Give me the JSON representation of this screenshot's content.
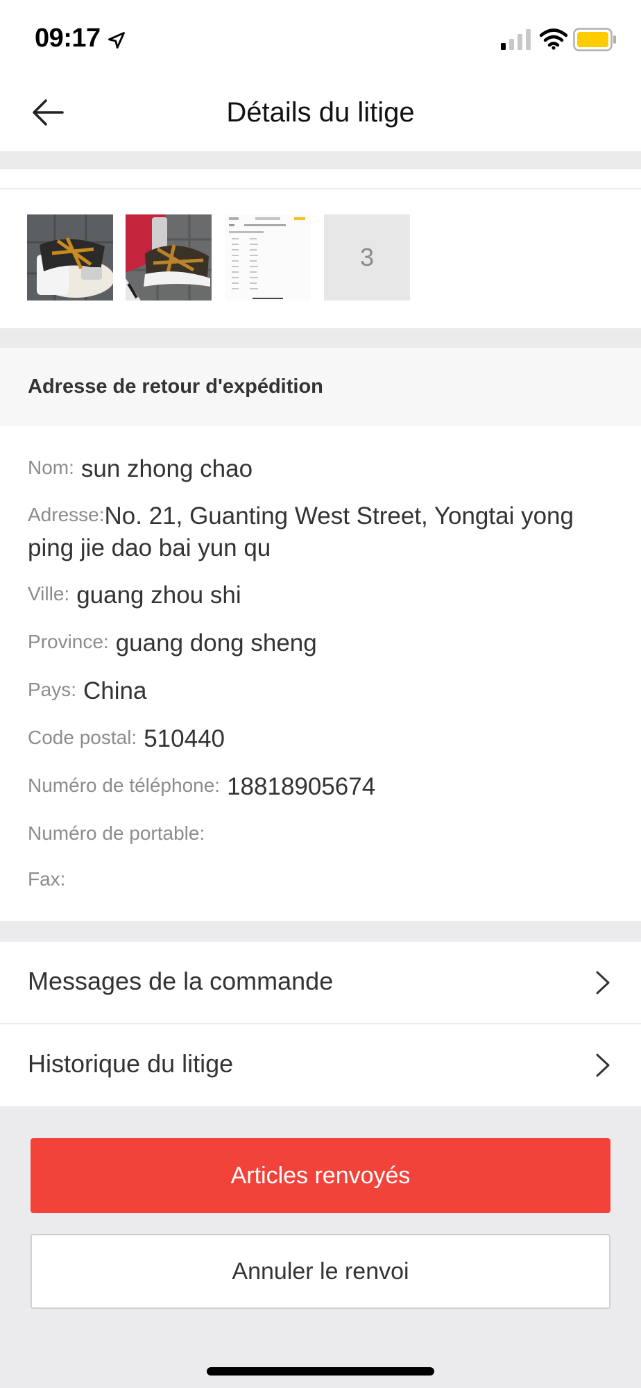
{
  "status_bar": {
    "time": "09:17",
    "icons": [
      "location-arrow-icon",
      "signal-icon",
      "wifi-icon",
      "battery-icon"
    ],
    "battery_color": "#ffcc00"
  },
  "nav": {
    "title": "Détails du litige",
    "back_icon": "arrow-left-icon"
  },
  "photos": {
    "more_count": "3"
  },
  "address_section": {
    "title": "Adresse de retour d'expédition",
    "fields": {
      "name": {
        "label": "Nom:",
        "value": "sun zhong chao"
      },
      "address": {
        "label": "Adresse:",
        "value": "No. 21, Guanting West Street, Yongtai yong ping jie dao bai yun qu"
      },
      "city": {
        "label": "Ville:",
        "value": "guang zhou shi"
      },
      "province": {
        "label": "Province:",
        "value": "guang dong sheng"
      },
      "country": {
        "label": "Pays:",
        "value": "China"
      },
      "postal_code": {
        "label": "Code postal:",
        "value": "510440"
      },
      "phone": {
        "label": "Numéro de téléphone:",
        "value": "18818905674"
      },
      "mobile": {
        "label": "Numéro de portable:",
        "value": ""
      },
      "fax": {
        "label": "Fax:",
        "value": ""
      }
    }
  },
  "links": {
    "order_messages": "Messages de la commande",
    "dispute_history": "Historique du litige"
  },
  "actions": {
    "returned_items": "Articles renvoyés",
    "cancel_return": "Annuler le renvoi"
  },
  "colors": {
    "primary": "#f2433a",
    "background": "#ebebed"
  }
}
